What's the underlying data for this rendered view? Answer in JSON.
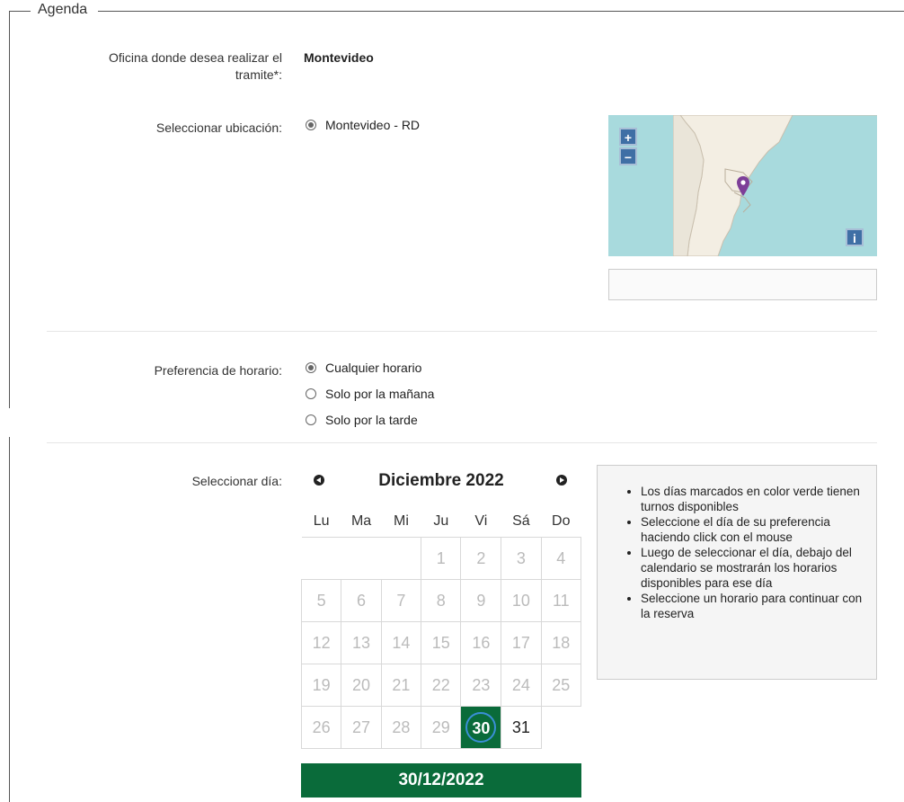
{
  "fieldset": {
    "legend": "Agenda"
  },
  "office": {
    "label": "Oficina donde desea realizar el tramite*:",
    "value": "Montevideo"
  },
  "location": {
    "label": "Seleccionar ubicación:",
    "options": [
      {
        "label": "Montevideo - RD",
        "checked": true
      }
    ],
    "map": {
      "zoom_in": "+",
      "zoom_out": "−",
      "info": "i",
      "search_value": ""
    }
  },
  "schedule": {
    "label": "Preferencia de horario:",
    "options": [
      {
        "label": "Cualquier horario",
        "checked": true
      },
      {
        "label": "Solo por la mañana",
        "checked": false
      },
      {
        "label": "Solo por la tarde",
        "checked": false
      }
    ]
  },
  "calendar": {
    "label": "Seleccionar día:",
    "title": "Diciembre 2022",
    "weekdays": [
      "Lu",
      "Ma",
      "Mi",
      "Ju",
      "Vi",
      "Sá",
      "Do"
    ],
    "weeks": [
      [
        "",
        "",
        "",
        "1",
        "2",
        "3",
        "4"
      ],
      [
        "5",
        "6",
        "7",
        "8",
        "9",
        "10",
        "11"
      ],
      [
        "12",
        "13",
        "14",
        "15",
        "16",
        "17",
        "18"
      ],
      [
        "19",
        "20",
        "21",
        "22",
        "23",
        "24",
        "25"
      ],
      [
        "26",
        "27",
        "28",
        "29",
        "30",
        "31",
        ""
      ]
    ],
    "selected_day": "30",
    "available_days": [
      "30",
      "31"
    ],
    "selected_date": "30/12/2022",
    "accent_color": "#0a6b3a"
  },
  "info": {
    "items": [
      "Los días marcados en color verde tienen turnos disponibles",
      "Seleccione el día de su preferencia haciendo click con el mouse",
      "Luego de seleccionar el día, debajo del calendario se mostrarán los horarios disponibles para ese día",
      "Seleccione un horario para continuar con la reserva"
    ]
  }
}
